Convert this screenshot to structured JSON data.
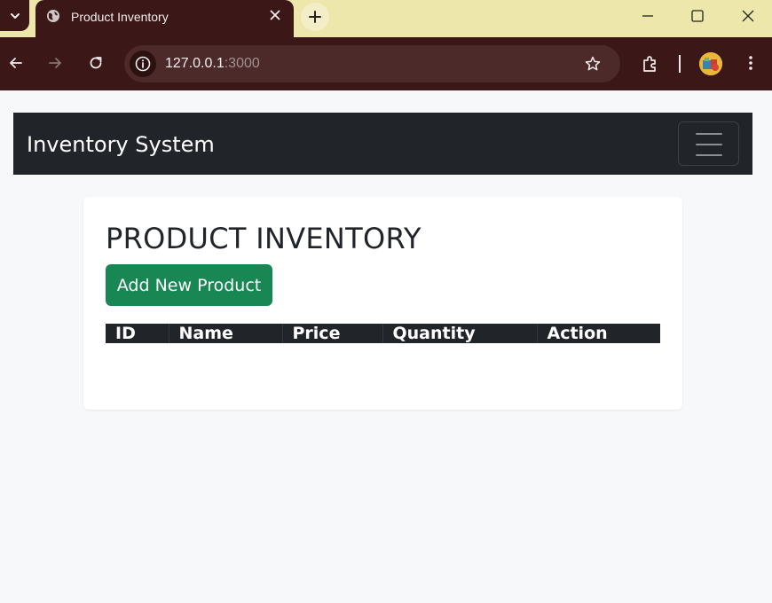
{
  "browser": {
    "tab_title": "Product Inventory",
    "url_host": "127.0.0.1",
    "url_port": ":3000",
    "icons": [
      "tab-search-icon",
      "globe-icon",
      "close-icon",
      "plus-icon",
      "minimize-icon",
      "maximize-icon",
      "window-close-icon",
      "back-arrow-icon",
      "forward-arrow-icon",
      "reload-icon",
      "info-icon",
      "star-icon",
      "extensions-icon",
      "profile-avatar",
      "more-vert-icon"
    ]
  },
  "navbar": {
    "brand": "Inventory System",
    "toggler_icon": "hamburger-icon"
  },
  "main": {
    "heading": "PRODUCT INVENTORY",
    "add_button": "Add New Product",
    "table": {
      "columns": [
        "ID",
        "Name",
        "Price",
        "Quantity",
        "Action"
      ],
      "rows": []
    }
  },
  "colors": {
    "chrome_dark": "#3b1717",
    "tabstrip": "#ede7ab",
    "navbar": "#212529",
    "success_button": "#198754",
    "page_background": "#f7f8fa"
  }
}
